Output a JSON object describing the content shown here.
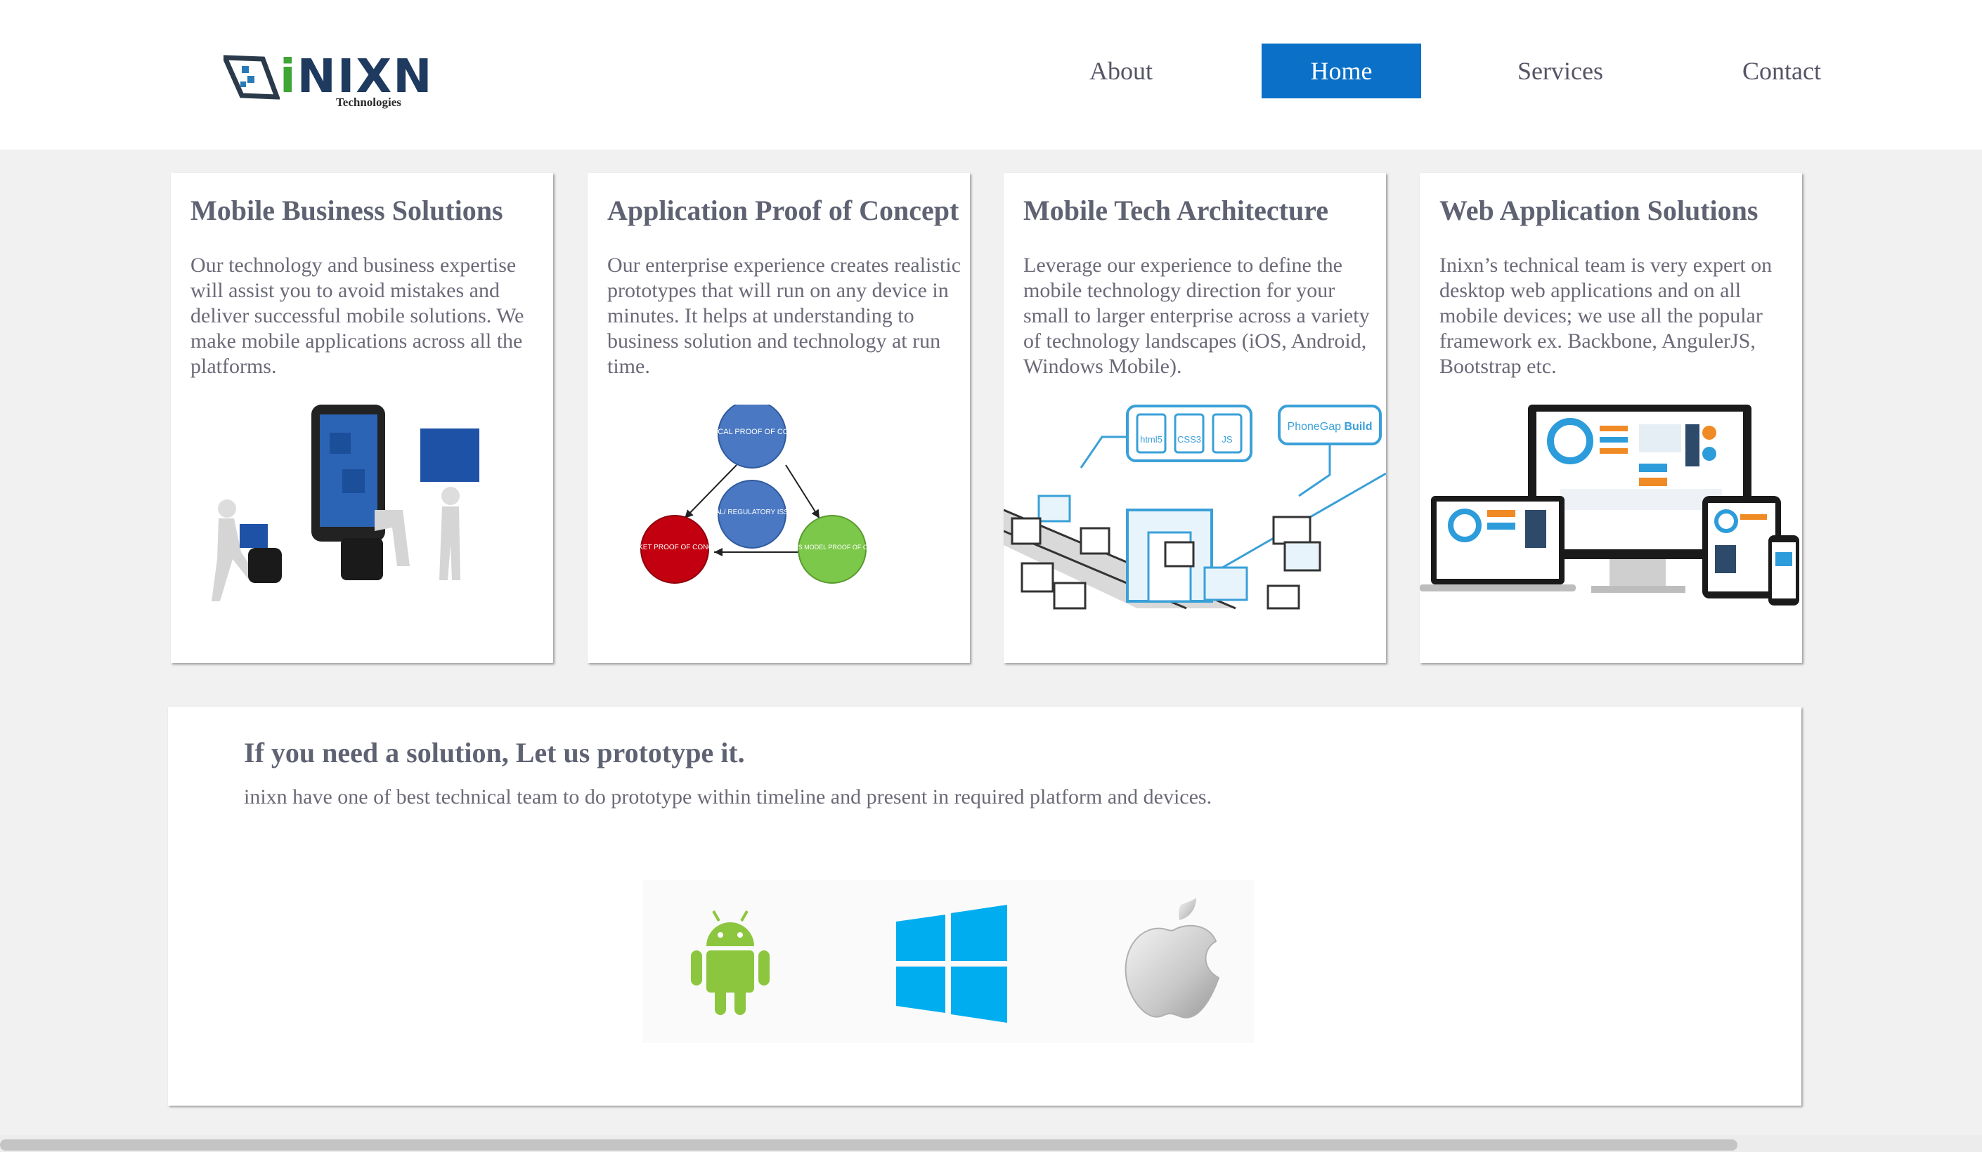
{
  "brand": {
    "name_part1": "i",
    "name_part2": "NIXN",
    "tagline": "Technologies"
  },
  "nav": {
    "items": [
      {
        "label": "About",
        "active": false
      },
      {
        "label": "Home",
        "active": true
      },
      {
        "label": "Services",
        "active": false
      },
      {
        "label": "Contact",
        "active": false
      }
    ]
  },
  "cards": [
    {
      "title": "Mobile Business Solutions",
      "text": "Our technology and business expertise will assist you to avoid mistakes and deliver successful mobile solutions. We make mobile applications across all the platforms."
    },
    {
      "title": "Application Proof of Concept",
      "text": "Our enterprise experience creates realistic prototypes that will run on any device in minutes. It helps at understanding to business solution and technology at run time.",
      "diagram": {
        "top": "TECHNICAL PROOF OF CONCEPT",
        "center": "LEGAL/ REGULATORY ISSUES",
        "left": "MARKET PROOF OF CONCEPT",
        "right": "BUSINESS MODEL PROOF OF CONCEPT"
      }
    },
    {
      "title": "Mobile Tech Architecture",
      "text": "Leverage our experience to define the mobile technology direction for your small to larger enterprise across a variety of technology landscapes (iOS, Android, Windows Mobile).",
      "diagram": {
        "files": [
          "html5",
          "CSS3",
          "JS"
        ],
        "build_label_part1": "PhoneGap",
        "build_label_part2": "Build"
      }
    },
    {
      "title": "Web Application Solutions",
      "text": "Inixn’s technical team is very expert on desktop web applications and on all mobile devices; we use all the popular framework ex. Backbone, AngulerJS, Bootstrap etc."
    }
  ],
  "prototype": {
    "heading": "If you need a solution, Let us prototype it.",
    "text": "inixn have one of best technical team to do prototype within timeline and present in required platform and devices.",
    "platform_icons": [
      "android-icon",
      "windows-icon",
      "apple-icon"
    ]
  },
  "colors": {
    "accent": "#0a70c8",
    "android": "#8cc63e",
    "windows": "#00adef",
    "background": "#f1f1f1"
  }
}
